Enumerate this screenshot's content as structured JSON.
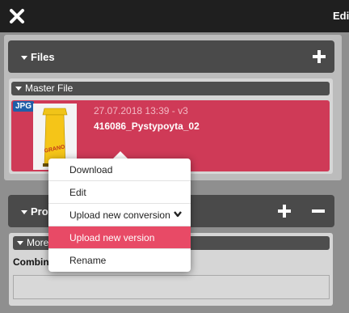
{
  "topbar": {
    "title": "Edi",
    "close_icon": "close-icon"
  },
  "files_section": {
    "title": "Files",
    "add_icon": "plus-icon",
    "master": {
      "title": "Master File",
      "file": {
        "type_badge": "JPG",
        "date": "27.07.2018 13:39 - v3",
        "name": "416086_Pystypoyta_02",
        "thumbnail_text": "GRANO",
        "card_color": "#cf3a57"
      }
    }
  },
  "context_menu": {
    "items": [
      {
        "label": "Download"
      },
      {
        "label": "Edit"
      },
      {
        "label": "Upload new conversion",
        "icon": "chevron-down-icon"
      },
      {
        "label": "Upload new version",
        "active": true
      },
      {
        "label": "Rename"
      }
    ],
    "active_color": "#e84a66"
  },
  "properties_section": {
    "title": "Prope",
    "add_icon": "plus-icon",
    "remove_icon": "minus-icon",
    "more": {
      "title": "More"
    },
    "combine_label": "Combin",
    "field_value": ""
  }
}
